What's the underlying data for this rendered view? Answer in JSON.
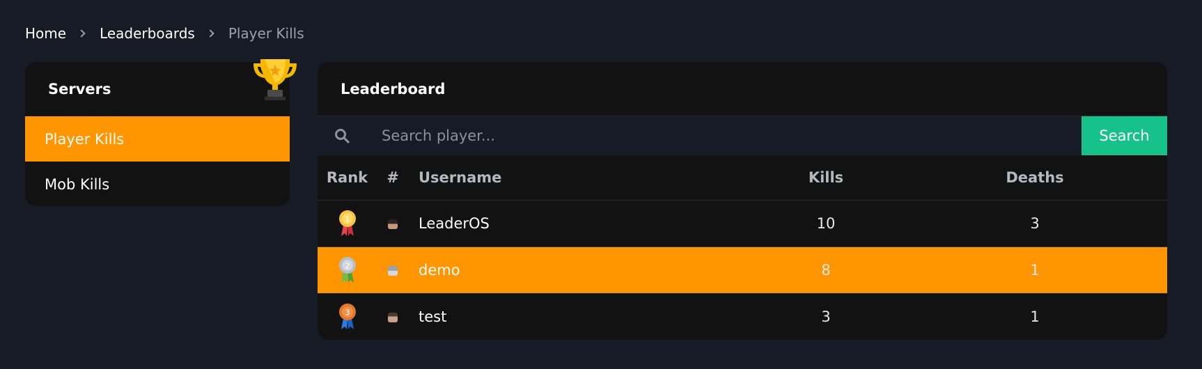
{
  "breadcrumb": {
    "items": [
      "Home",
      "Leaderboards",
      "Player Kills"
    ]
  },
  "sidebar": {
    "title": "Servers",
    "items": [
      {
        "label": "Player Kills",
        "active": true
      },
      {
        "label": "Mob Kills",
        "active": false
      }
    ]
  },
  "leaderboard": {
    "title": "Leaderboard",
    "search": {
      "placeholder": "Search player...",
      "value": "",
      "button_label": "Search"
    },
    "columns": {
      "rank": "Rank",
      "avatar": "#",
      "username": "Username",
      "kills": "Kills",
      "deaths": "Deaths"
    },
    "rows": [
      {
        "rank": "1",
        "username": "LeaderOS",
        "kills": "10",
        "deaths": "3",
        "medal_color": "#f6c344",
        "ribbon_color": "#e8414f"
      },
      {
        "rank": "2",
        "username": "demo",
        "kills": "8",
        "deaths": "1",
        "medal_color": "#b8bcc4",
        "ribbon_color": "#6cc04a"
      },
      {
        "rank": "3",
        "username": "test",
        "kills": "3",
        "deaths": "1",
        "medal_color": "#e0782e",
        "ribbon_color": "#2d7be0"
      }
    ]
  },
  "colors": {
    "accent": "#ff9500",
    "search_button": "#17c28a",
    "background": "#171b26",
    "card": "#121212"
  }
}
